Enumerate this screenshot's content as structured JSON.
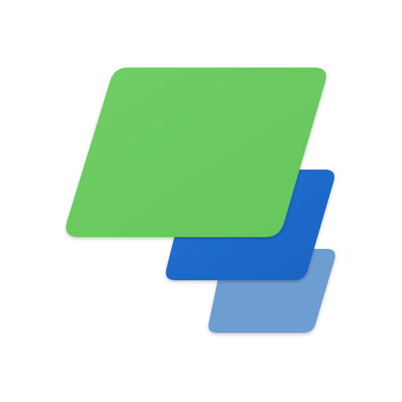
{
  "icon": {
    "name": "stacked-layers-logo-icon",
    "colors": {
      "background": "#ffffff",
      "front_layer": "#6ACB61",
      "middle_layer": "#1F6BCC",
      "back_layer": "#6E9DD1"
    }
  }
}
